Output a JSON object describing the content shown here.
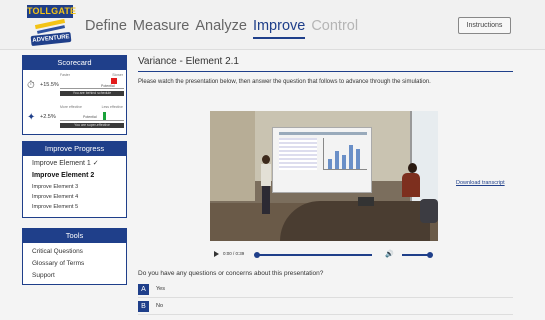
{
  "logo": {
    "line1": "TOLLGATE",
    "line2": "ADVENTURE"
  },
  "nav": {
    "items": [
      {
        "label": "Define",
        "state": "normal"
      },
      {
        "label": "Measure",
        "state": "normal"
      },
      {
        "label": "Analyze",
        "state": "normal"
      },
      {
        "label": "Improve",
        "state": "active"
      },
      {
        "label": "Control",
        "state": "disabled"
      }
    ]
  },
  "header": {
    "instructions_label": "Instructions"
  },
  "scorecard": {
    "title": "Scorecard",
    "rows": [
      {
        "icon": "stopwatch-icon",
        "value": "+15.5%",
        "left_label": "Faster",
        "right_label": "Slower",
        "potential_label": "Potential",
        "status": "You are behind schedule",
        "status_color": "#e21b1b"
      },
      {
        "icon": "budget-icon",
        "value": "+2.5%",
        "left_label": "More effective",
        "right_label": "Less effective",
        "potential_label": "Potential",
        "status": "You are super-effective",
        "status_color": "#19a23a"
      }
    ]
  },
  "progress": {
    "title": "Improve Progress",
    "items": [
      "Improve Element 1",
      "Improve Element 2",
      "Improve Element 3",
      "Improve Element 4",
      "Improve Element 5"
    ],
    "first_suffix": "✓"
  },
  "tools": {
    "title": "Tools",
    "items": [
      "Critical Questions",
      "Glossary of Terms",
      "Support"
    ]
  },
  "main": {
    "title": "Variance - Element 2.1",
    "instructions": "Please watch the presentation below, then answer the question that follows to advance through the simulation.",
    "video": {
      "time": "0:00 / 0:39",
      "progress": 0.0,
      "volume": 1.0
    },
    "download_label": "Download transcript",
    "question": "Do you have any questions or concerns about this presentation?",
    "answers": [
      {
        "key": "A",
        "label": "Yes"
      },
      {
        "key": "B",
        "label": "No"
      }
    ]
  },
  "colors": {
    "accent": "#1f3f8a",
    "logo_yellow": "#f3c316",
    "red": "#e21b1b",
    "green": "#19a23a"
  }
}
